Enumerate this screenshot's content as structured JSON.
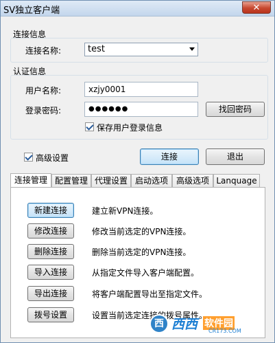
{
  "window": {
    "title": "SV独立客户端",
    "close_symbol": "✕"
  },
  "connection": {
    "group_title": "连接信息",
    "name_label": "连接名称:",
    "name_value": "test"
  },
  "auth": {
    "group_title": "认证信息",
    "user_label": "用户名称:",
    "user_value": "xzjy0001",
    "password_label": "登录密码:",
    "password_value": "●●●●●●",
    "recover_button": "找回密码",
    "save_login_label": "保存用户登录信息",
    "save_login_checked": true
  },
  "advanced": {
    "label": "高级设置",
    "checked": true
  },
  "buttons": {
    "connect": "连接",
    "exit": "退出"
  },
  "tabs": [
    {
      "label": "连接管理",
      "active": true
    },
    {
      "label": "配置管理",
      "active": false
    },
    {
      "label": "代理设置",
      "active": false
    },
    {
      "label": "启动选项",
      "active": false
    },
    {
      "label": "高级选项",
      "active": false
    },
    {
      "label": "Lanquage",
      "active": false
    }
  ],
  "actions": [
    {
      "label": "新建连接",
      "desc": "建立新VPN连接。"
    },
    {
      "label": "修改连接",
      "desc": "修改当前选定的VPN连接。"
    },
    {
      "label": "删除连接",
      "desc": "删除当前选定的VPN连接。"
    },
    {
      "label": "导入连接",
      "desc": "从指定文件导入客户端配置。"
    },
    {
      "label": "导出连接",
      "desc": "将客户端配置导出至指定文件。"
    },
    {
      "label": "拨号设置",
      "desc": "设置当前选定连接的拨号属性。"
    }
  ],
  "watermark": {
    "logo": "西",
    "name": "西西",
    "badge": "软件园",
    "sub": "CR173.COM"
  }
}
